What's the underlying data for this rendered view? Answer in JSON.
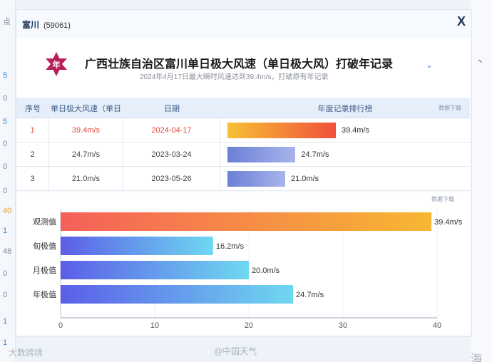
{
  "background": {
    "left_labels": [
      "点",
      "5",
      "0",
      "5",
      "0",
      "0",
      "0",
      "40",
      "1",
      "48",
      "0",
      "0",
      "1",
      "1"
    ],
    "right_labels": [
      "丶",
      "至"
    ],
    "watermarks": [
      "大数跨境",
      "@中国天气",
      "海"
    ]
  },
  "panel": {
    "station_name": "富川",
    "station_code": "(59061)",
    "close_label": "X",
    "badge_text": "年",
    "title": "广西壮族自治区富川单日极大风速（单日极大风）打破年记录",
    "subtitle": "2024年4月17日最大瞬时风速达到39.4m/s，打破原有年记录",
    "chevron": "⌄"
  },
  "table": {
    "headers": [
      "序号",
      "单日极大风速（单日",
      "日期",
      "年度记录排行榜"
    ],
    "download_label": "数据下载",
    "rows": [
      {
        "rank": "1",
        "speed": "39.4m/s",
        "date": "2024-04-17",
        "value": 39.4,
        "label": "39.4m/s"
      },
      {
        "rank": "2",
        "speed": "24.7m/s",
        "date": "2023-03-24",
        "value": 24.7,
        "label": "24.7m/s"
      },
      {
        "rank": "3",
        "speed": "21.0m/s",
        "date": "2023-05-26",
        "value": 21.0,
        "label": "21.0m/s"
      }
    ],
    "colors": {
      "first_start": "#f7c035",
      "first_end": "#f0503a",
      "other_start": "#6b7fd6",
      "other_end": "#a8b4ea"
    }
  },
  "chart_data": {
    "type": "bar",
    "orientation": "horizontal",
    "categories": [
      "观测值",
      "旬极值",
      "月极值",
      "年极值"
    ],
    "values": [
      39.4,
      16.2,
      20.0,
      24.7
    ],
    "labels": [
      "39.4m/s",
      "16.2m/s",
      "20.0m/s",
      "24.7m/s"
    ],
    "xlim": [
      0,
      40
    ],
    "xticks": [
      "0",
      "10",
      "20",
      "30",
      "40"
    ],
    "grid": true,
    "download_label": "数据下载",
    "colors": {
      "obs_start": "#f5605a",
      "obs_end": "#f7b733",
      "ext_start": "#5b5ee8",
      "ext_end": "#6fd8f0"
    }
  }
}
